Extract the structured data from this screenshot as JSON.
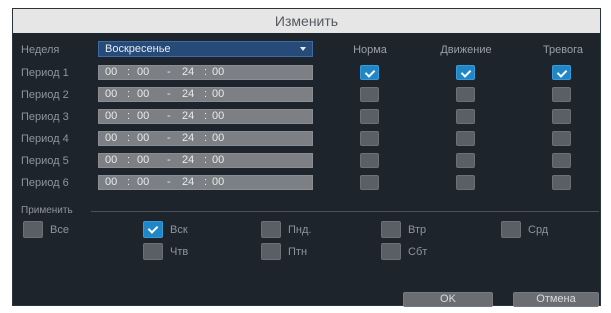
{
  "title": "Изменить",
  "week": {
    "label": "Неделя",
    "selected": "Воскресенье"
  },
  "columns": {
    "normal": "Норма",
    "motion": "Движение",
    "alarm": "Тревога"
  },
  "periods": [
    {
      "label": "Период 1",
      "start_h": "00",
      "start_m": "00",
      "end_h": "24",
      "end_m": "00",
      "normal": true,
      "motion": true,
      "alarm": true
    },
    {
      "label": "Период 2",
      "start_h": "00",
      "start_m": "00",
      "end_h": "24",
      "end_m": "00",
      "normal": false,
      "motion": false,
      "alarm": false
    },
    {
      "label": "Период 3",
      "start_h": "00",
      "start_m": "00",
      "end_h": "24",
      "end_m": "00",
      "normal": false,
      "motion": false,
      "alarm": false
    },
    {
      "label": "Период 4",
      "start_h": "00",
      "start_m": "00",
      "end_h": "24",
      "end_m": "00",
      "normal": false,
      "motion": false,
      "alarm": false
    },
    {
      "label": "Период 5",
      "start_h": "00",
      "start_m": "00",
      "end_h": "24",
      "end_m": "00",
      "normal": false,
      "motion": false,
      "alarm": false
    },
    {
      "label": "Период 6",
      "start_h": "00",
      "start_m": "00",
      "end_h": "24",
      "end_m": "00",
      "normal": false,
      "motion": false,
      "alarm": false
    }
  ],
  "apply": {
    "label": "Применить",
    "days": [
      {
        "label": "Все",
        "checked": false
      },
      {
        "label": "Вск",
        "checked": true
      },
      {
        "label": "Пнд.",
        "checked": false
      },
      {
        "label": "Втр",
        "checked": false
      },
      {
        "label": "Срд",
        "checked": false
      },
      {
        "label": "Чтв",
        "checked": false
      },
      {
        "label": "Птн",
        "checked": false
      },
      {
        "label": "Сбт",
        "checked": false
      }
    ]
  },
  "buttons": {
    "ok": "OK",
    "cancel": "Отмена"
  },
  "colors": {
    "accent": "#1f86c8",
    "panel": "#1d242c",
    "titlebar": "#e6e6e6"
  }
}
